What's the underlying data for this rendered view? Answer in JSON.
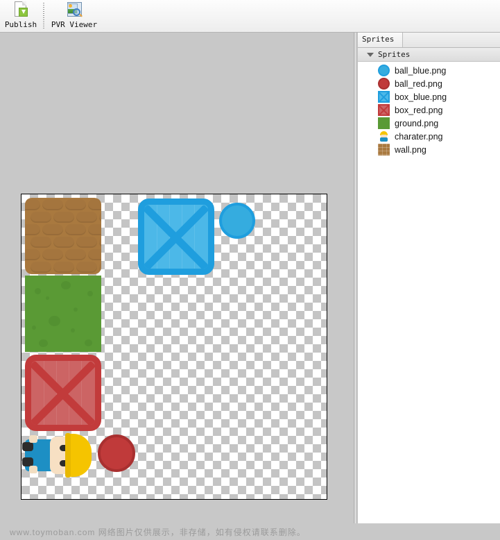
{
  "toolbar": {
    "items": [
      {
        "label": "Publish",
        "icon": "publish-page-icon"
      },
      {
        "label": "PVR Viewer",
        "icon": "pvr-viewer-icon"
      }
    ]
  },
  "panel": {
    "tab_label": "Sprites",
    "tree_root_label": "Sprites",
    "expander": "triangle-down-icon",
    "items": [
      {
        "label": "ball_blue.png",
        "icon": "circle-blue-icon",
        "color": "#35acdf"
      },
      {
        "label": "ball_red.png",
        "icon": "circle-red-icon",
        "color": "#c03a3a"
      },
      {
        "label": "box_blue.png",
        "icon": "box-blue-icon",
        "color": "#4cb8e8"
      },
      {
        "label": "box_red.png",
        "icon": "box-red-icon",
        "color": "#cc6464"
      },
      {
        "label": "ground.png",
        "icon": "square-green-icon",
        "color": "#5a9a35"
      },
      {
        "label": "charater.png",
        "icon": "character-icon",
        "color": "#f5c400"
      },
      {
        "label": "wall.png",
        "icon": "brick-wall-icon",
        "color": "#a9793f"
      }
    ]
  },
  "canvas": {
    "sprites": [
      {
        "name": "wall.png",
        "color": "#a9793f"
      },
      {
        "name": "ground.png",
        "color": "#5a9a35"
      },
      {
        "name": "box_blue.png",
        "color": "#1f9ede"
      },
      {
        "name": "ball_blue.png",
        "color": "#35acdf"
      },
      {
        "name": "box_red.png",
        "color": "#c23b3b"
      },
      {
        "name": "charater.png",
        "color": "#f5c400"
      },
      {
        "name": "ball_red.png",
        "color": "#c03a3a"
      }
    ]
  },
  "footer": {
    "watermark": "www.toymoban.com 网络图片仅供展示，非存储，如有侵权请联系删除。"
  },
  "colors": {
    "window_bg": "#c8c8c8",
    "toolbar_bg": "#f2f2f2",
    "panel_bg": "#ffffff",
    "checker_light": "#ffffff",
    "checker_dark": "#c4c4c4"
  }
}
